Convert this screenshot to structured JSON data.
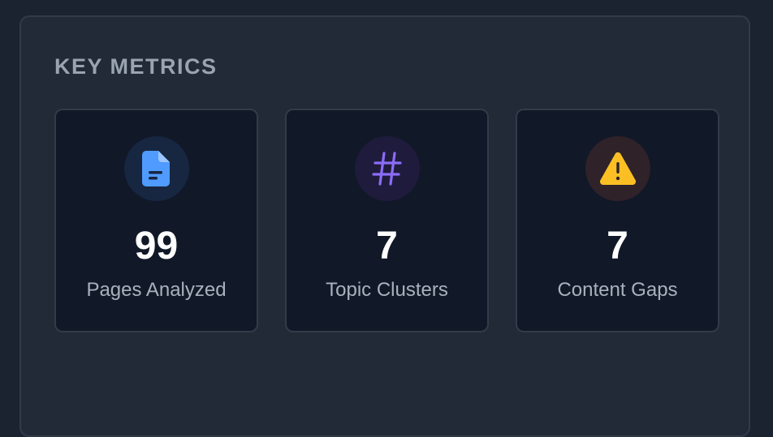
{
  "panel": {
    "title": "KEY METRICS"
  },
  "metrics": [
    {
      "icon": "document-icon",
      "color": "#4f9bff",
      "value": "99",
      "label": "Pages Analyzed"
    },
    {
      "icon": "hashtag-icon",
      "color": "#8b6cf7",
      "value": "7",
      "label": "Topic Clusters"
    },
    {
      "icon": "warning-icon",
      "color": "#fbbf24",
      "value": "7",
      "label": "Content Gaps"
    }
  ]
}
